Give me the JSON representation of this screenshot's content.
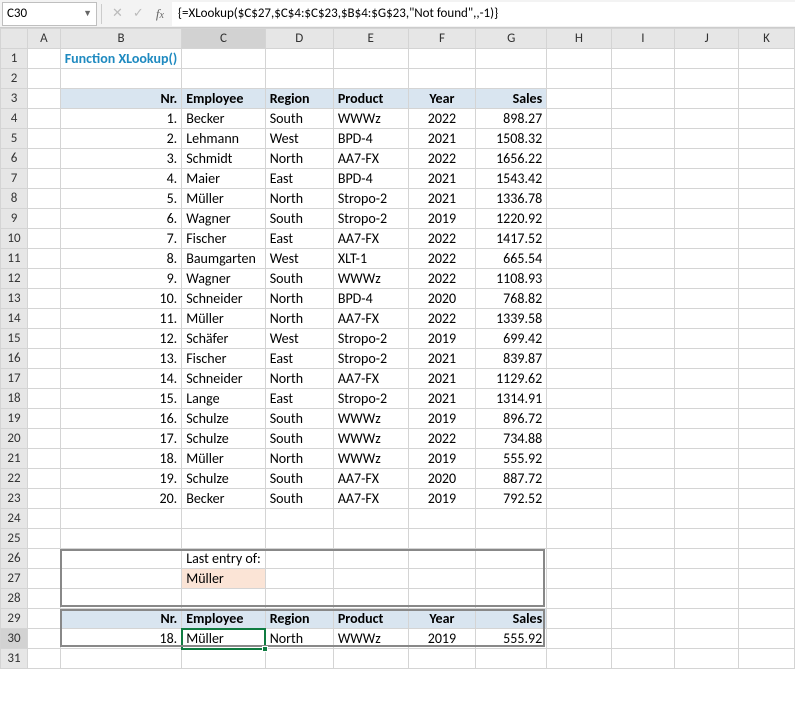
{
  "namebox": "C30",
  "formula": "{=XLookup($C$27,$C$4:$C$23,$B$4:$G$23,\"Not found\",,-1)}",
  "columns": [
    "A",
    "B",
    "C",
    "D",
    "E",
    "F",
    "G",
    "H",
    "I",
    "J",
    "K"
  ],
  "title": "Function XLookup()",
  "headers": {
    "nr": "Nr.",
    "employee": "Employee",
    "region": "Region",
    "product": "Product",
    "year": "Year",
    "sales": "Sales"
  },
  "rows": [
    {
      "nr": "1.",
      "employee": "Becker",
      "region": "South",
      "product": "WWWz",
      "year": "2022",
      "sales": "898.27"
    },
    {
      "nr": "2.",
      "employee": "Lehmann",
      "region": "West",
      "product": "BPD-4",
      "year": "2021",
      "sales": "1508.32"
    },
    {
      "nr": "3.",
      "employee": "Schmidt",
      "region": "North",
      "product": "AA7-FX",
      "year": "2022",
      "sales": "1656.22"
    },
    {
      "nr": "4.",
      "employee": "Maier",
      "region": "East",
      "product": "BPD-4",
      "year": "2021",
      "sales": "1543.42"
    },
    {
      "nr": "5.",
      "employee": "Müller",
      "region": "North",
      "product": "Stropo-2",
      "year": "2021",
      "sales": "1336.78"
    },
    {
      "nr": "6.",
      "employee": "Wagner",
      "region": "South",
      "product": "Stropo-2",
      "year": "2019",
      "sales": "1220.92"
    },
    {
      "nr": "7.",
      "employee": "Fischer",
      "region": "East",
      "product": "AA7-FX",
      "year": "2022",
      "sales": "1417.52"
    },
    {
      "nr": "8.",
      "employee": "Baumgarten",
      "region": "West",
      "product": "XLT-1",
      "year": "2022",
      "sales": "665.54"
    },
    {
      "nr": "9.",
      "employee": "Wagner",
      "region": "South",
      "product": "WWWz",
      "year": "2022",
      "sales": "1108.93"
    },
    {
      "nr": "10.",
      "employee": "Schneider",
      "region": "North",
      "product": "BPD-4",
      "year": "2020",
      "sales": "768.82"
    },
    {
      "nr": "11.",
      "employee": "Müller",
      "region": "North",
      "product": "AA7-FX",
      "year": "2022",
      "sales": "1339.58"
    },
    {
      "nr": "12.",
      "employee": "Schäfer",
      "region": "West",
      "product": "Stropo-2",
      "year": "2019",
      "sales": "699.42"
    },
    {
      "nr": "13.",
      "employee": "Fischer",
      "region": "East",
      "product": "Stropo-2",
      "year": "2021",
      "sales": "839.87"
    },
    {
      "nr": "14.",
      "employee": "Schneider",
      "region": "North",
      "product": "AA7-FX",
      "year": "2021",
      "sales": "1129.62"
    },
    {
      "nr": "15.",
      "employee": "Lange",
      "region": "East",
      "product": "Stropo-2",
      "year": "2021",
      "sales": "1314.91"
    },
    {
      "nr": "16.",
      "employee": "Schulze",
      "region": "South",
      "product": "WWWz",
      "year": "2019",
      "sales": "896.72"
    },
    {
      "nr": "17.",
      "employee": "Schulze",
      "region": "South",
      "product": "WWWz",
      "year": "2022",
      "sales": "734.88"
    },
    {
      "nr": "18.",
      "employee": "Müller",
      "region": "North",
      "product": "WWWz",
      "year": "2019",
      "sales": "555.92"
    },
    {
      "nr": "19.",
      "employee": "Schulze",
      "region": "South",
      "product": "AA7-FX",
      "year": "2020",
      "sales": "887.72"
    },
    {
      "nr": "20.",
      "employee": "Becker",
      "region": "South",
      "product": "AA7-FX",
      "year": "2019",
      "sales": "792.52"
    }
  ],
  "lookup": {
    "label": "Last entry of:",
    "value": "Müller"
  },
  "result": {
    "nr": "18.",
    "employee": "Müller",
    "region": "North",
    "product": "WWWz",
    "year": "2019",
    "sales": "555.92"
  },
  "chart_data": {
    "type": "table",
    "title": "Function XLookup()",
    "columns": [
      "Nr.",
      "Employee",
      "Region",
      "Product",
      "Year",
      "Sales"
    ],
    "series": [
      {
        "name": "Nr.",
        "values": [
          1,
          2,
          3,
          4,
          5,
          6,
          7,
          8,
          9,
          10,
          11,
          12,
          13,
          14,
          15,
          16,
          17,
          18,
          19,
          20
        ]
      },
      {
        "name": "Employee",
        "values": [
          "Becker",
          "Lehmann",
          "Schmidt",
          "Maier",
          "Müller",
          "Wagner",
          "Fischer",
          "Baumgarten",
          "Wagner",
          "Schneider",
          "Müller",
          "Schäfer",
          "Fischer",
          "Schneider",
          "Lange",
          "Schulze",
          "Schulze",
          "Müller",
          "Schulze",
          "Becker"
        ]
      },
      {
        "name": "Region",
        "values": [
          "South",
          "West",
          "North",
          "East",
          "North",
          "South",
          "East",
          "West",
          "South",
          "North",
          "North",
          "West",
          "East",
          "North",
          "East",
          "South",
          "South",
          "North",
          "South",
          "South"
        ]
      },
      {
        "name": "Product",
        "values": [
          "WWWz",
          "BPD-4",
          "AA7-FX",
          "BPD-4",
          "Stropo-2",
          "Stropo-2",
          "AA7-FX",
          "XLT-1",
          "WWWz",
          "BPD-4",
          "AA7-FX",
          "Stropo-2",
          "Stropo-2",
          "AA7-FX",
          "Stropo-2",
          "WWWz",
          "WWWz",
          "WWWz",
          "AA7-FX",
          "AA7-FX"
        ]
      },
      {
        "name": "Year",
        "values": [
          2022,
          2021,
          2022,
          2021,
          2021,
          2019,
          2022,
          2022,
          2022,
          2020,
          2022,
          2019,
          2021,
          2021,
          2021,
          2019,
          2022,
          2019,
          2020,
          2019
        ]
      },
      {
        "name": "Sales",
        "values": [
          898.27,
          1508.32,
          1656.22,
          1543.42,
          1336.78,
          1220.92,
          1417.52,
          665.54,
          1108.93,
          768.82,
          1339.58,
          699.42,
          839.87,
          1129.62,
          1314.91,
          896.72,
          734.88,
          555.92,
          887.72,
          792.52
        ]
      }
    ]
  }
}
